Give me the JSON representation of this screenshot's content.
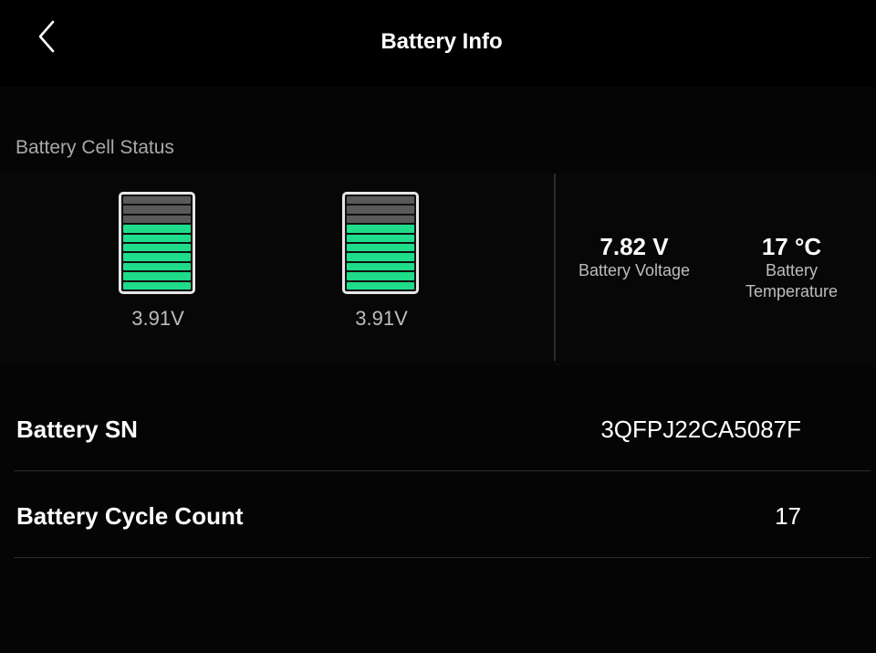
{
  "header": {
    "back_icon": "chevron-left-icon",
    "title": "Battery Info"
  },
  "cell_status": {
    "section_title": "Battery Cell Status",
    "cells": [
      {
        "voltage": "3.91V",
        "level_bars_total": 10,
        "level_bars_filled": 7
      },
      {
        "voltage": "3.91V",
        "level_bars_total": 10,
        "level_bars_filled": 7
      }
    ],
    "colors": {
      "filled": "#1edc8a",
      "empty": "#5a5a5a"
    }
  },
  "stats": {
    "voltage": {
      "value": "7.82 V",
      "label": "Battery Voltage"
    },
    "temperature": {
      "value": "17 °C",
      "label_line1": "Battery",
      "label_line2": "Temperature"
    }
  },
  "info_rows": {
    "serial": {
      "label": "Battery SN",
      "value": "3QFPJ22CA5087F"
    },
    "cycle_count": {
      "label": "Battery Cycle Count",
      "value": "17"
    }
  }
}
